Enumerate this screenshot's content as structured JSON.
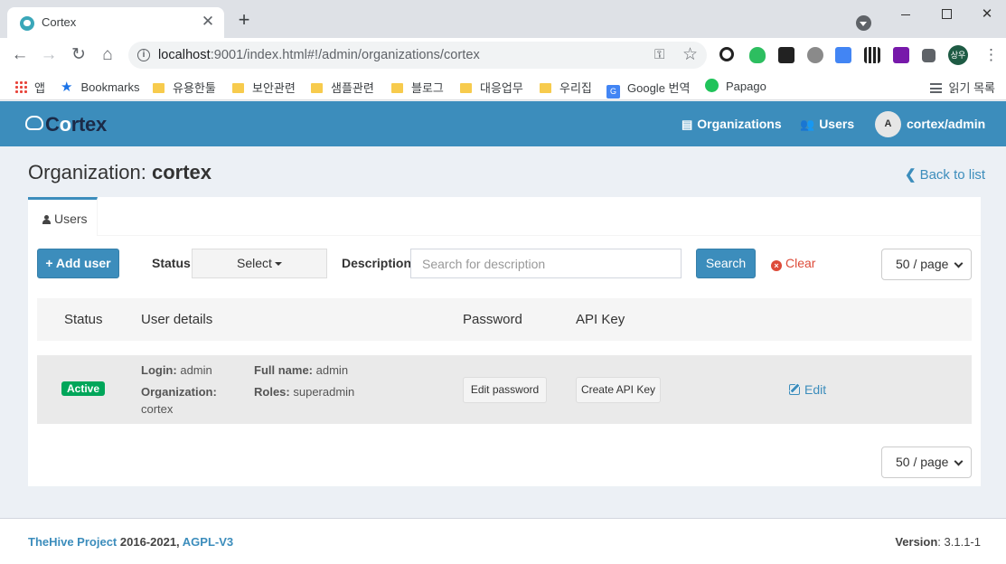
{
  "browser": {
    "tab_title": "Cortex",
    "url_host": "localhost",
    "url_rest": ":9001/index.html#!/admin/organizations/cortex",
    "profile_initials": "상우",
    "bookmarks": [
      {
        "label": "앱"
      },
      {
        "label": "Bookmarks"
      },
      {
        "label": "유용한툴"
      },
      {
        "label": "보안관련"
      },
      {
        "label": "샘플관련"
      },
      {
        "label": "블로그"
      },
      {
        "label": "대응업무"
      },
      {
        "label": "우리집"
      },
      {
        "label": "Google 번역"
      },
      {
        "label": "Papago"
      }
    ],
    "reading_list": "읽기 목록"
  },
  "app": {
    "brand": {
      "pre": "C",
      "o": "o",
      "post": "rtex"
    },
    "nav": {
      "organizations": "Organizations",
      "users": "Users",
      "user_initial": "A",
      "user_name": "cortex/admin"
    },
    "page": {
      "title_prefix": "Organization:",
      "title_name": "cortex",
      "back_label": "Back to list"
    },
    "tabs": [
      {
        "label": "Users"
      }
    ],
    "toolbar": {
      "add_user": "Add user",
      "status_label": "Status",
      "status_select": "Select",
      "description_label": "Description",
      "description_placeholder": "Search for description",
      "search": "Search",
      "clear": "Clear",
      "page_size": "50 / page"
    },
    "table": {
      "headers": [
        "Status",
        "User details",
        "Password",
        "API Key"
      ],
      "rows": [
        {
          "status": "Active",
          "login_label": "Login:",
          "login": "admin",
          "org_label": "Organization:",
          "org": "cortex",
          "fullname_label": "Full name:",
          "fullname": "admin",
          "roles_label": "Roles:",
          "roles": "superadmin",
          "password_btn": "Edit password",
          "apikey_btn": "Create API Key",
          "edit": "Edit"
        }
      ]
    },
    "footer": {
      "project": "TheHive Project",
      "years": " 2016-2021, ",
      "license": "AGPL-V3",
      "version_label": "Version",
      "version": ": 3.1.1-1"
    }
  },
  "colors": {
    "accent": "#3c8dbc",
    "success": "#00a65a",
    "danger": "#dd4b39"
  }
}
